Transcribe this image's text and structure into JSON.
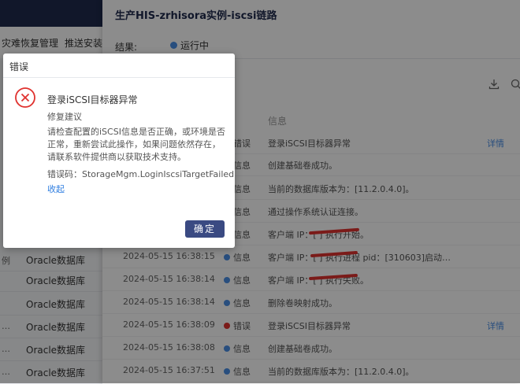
{
  "left_panel": {
    "tabs": [
      "灾难恢复管理",
      "推送安装与"
    ],
    "rows": [
      {
        "mark": "例",
        "name": "Oracle数据库"
      },
      {
        "mark": "",
        "name": "Oracle数据库"
      },
      {
        "mark": "",
        "name": "Oracle数据库"
      },
      {
        "mark": "…",
        "name": "Oracle数据库"
      },
      {
        "mark": "…",
        "name": "Oracle数据库"
      },
      {
        "mark": "…",
        "name": "Oracle数据库"
      }
    ]
  },
  "drawer": {
    "title": "生产HIS-zrhisora实例-iscsi链路",
    "result_label": "结果:",
    "result_value": "运行中",
    "col_info": "信息",
    "logs": [
      {
        "time": "",
        "level": "错误",
        "level_type": "error",
        "message": "登录iSCSI目标器异常",
        "action": "详情"
      },
      {
        "time": "",
        "level": "信息",
        "level_type": "info",
        "message": "创建基础卷成功。",
        "action": ""
      },
      {
        "time": "",
        "level": "信息",
        "level_type": "info",
        "message": "当前的数据库版本为：[11.2.0.4.0]。",
        "action": ""
      },
      {
        "time": "",
        "level": "信息",
        "level_type": "info",
        "message": "通过操作系统认证连接。",
        "action": ""
      },
      {
        "time": "",
        "level": "信息",
        "level_type": "info",
        "message": "客户端 IP：[              ] 执行开始。",
        "action": ""
      },
      {
        "time": "2024-05-15 16:38:15",
        "level": "信息",
        "level_type": "info",
        "message": "客户端 IP：[              ] 执行进程 pid：[310603]启动…",
        "action": ""
      },
      {
        "time": "2024-05-15 16:38:14",
        "level": "信息",
        "level_type": "info",
        "message": "客户端 IP：[              ] 执行失败。",
        "action": ""
      },
      {
        "time": "2024-05-15 16:38:14",
        "level": "信息",
        "level_type": "info",
        "message": "删除卷映射成功。",
        "action": ""
      },
      {
        "time": "2024-05-15 16:38:09",
        "level": "错误",
        "level_type": "error",
        "message": "登录iSCSI目标器异常",
        "action": "详情"
      },
      {
        "time": "2024-05-15 16:38:08",
        "level": "信息",
        "level_type": "info",
        "message": "创建基础卷成功。",
        "action": ""
      },
      {
        "time": "2024-05-15 16:37:51",
        "level": "信息",
        "level_type": "info",
        "message": "当前的数据库版本为：[11.2.0.4.0]。",
        "action": ""
      }
    ]
  },
  "modal": {
    "title": "错误",
    "heading": "登录iSCSI目标器异常",
    "repair_label": "修复建议",
    "body": "请检查配置的iSCSI信息是否正确，或环境是否正常，重新尝试此操作，如果问题依然存在，请联系软件提供商以获取技术支持。",
    "error_code": "错误码：StorageMgm.LoginIscsiTargetFailed",
    "collapse": "收起",
    "ok_button": "确定"
  },
  "colors": {
    "error": "#e0322f",
    "info": "#4a8ee5",
    "primary_button": "#3a4a82",
    "link": "#2f7ee0"
  }
}
